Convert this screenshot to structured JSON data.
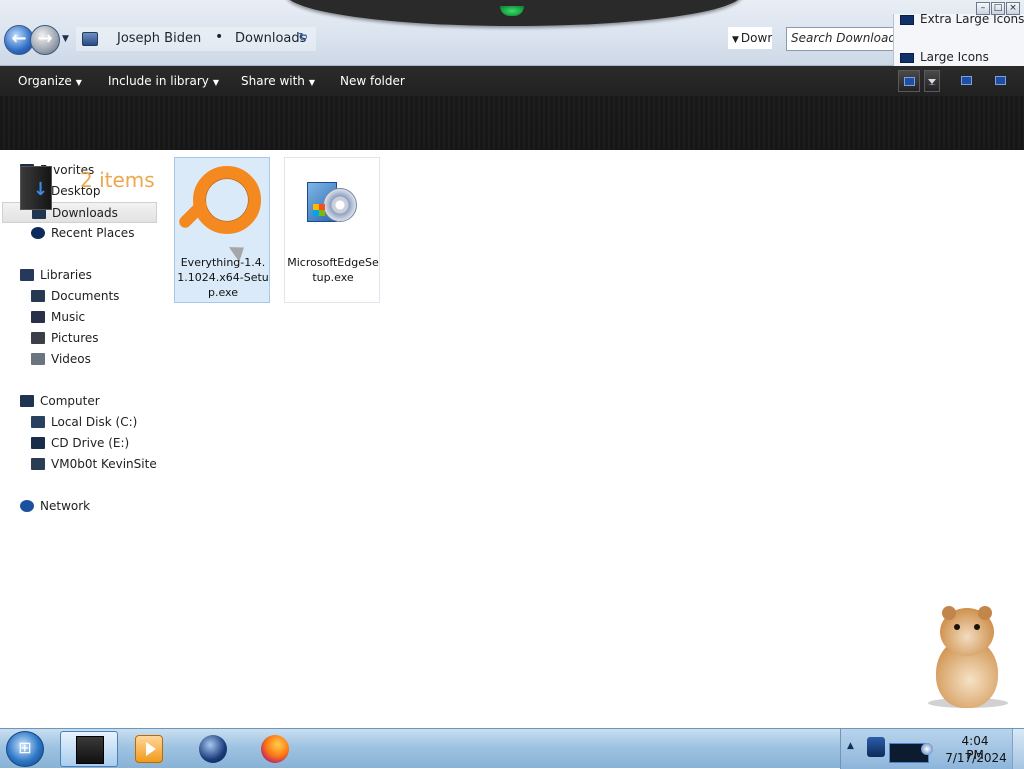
{
  "window": {
    "breadcrumb": [
      "Joseph Biden",
      "Downloads"
    ],
    "breadcrumb_separator": "•",
    "search_placeholder": "Search Downloads",
    "view_button_partial": "Dowr",
    "view_options": [
      "Extra Large Icons",
      "Large Icons"
    ],
    "controls": {
      "minimize": "–",
      "maximize": "□",
      "close": "×"
    }
  },
  "toolbar": {
    "organize": "Organize",
    "include_in_library": "Include in library",
    "share_with": "Share with",
    "new_folder": "New folder",
    "dropdown_glyph": "▼"
  },
  "header": {
    "item_count": "2 items",
    "accent_color": "#f0a64a"
  },
  "sidebar": {
    "favorites": {
      "label": "Favorites",
      "items": [
        "Desktop",
        "Downloads",
        "Recent Places"
      ],
      "selected": "Downloads"
    },
    "libraries": {
      "label": "Libraries",
      "items": [
        "Documents",
        "Music",
        "Pictures",
        "Videos"
      ]
    },
    "computer": {
      "label": "Computer",
      "items": [
        "Local Disk (C:)",
        "CD Drive (E:)",
        "VM0b0t KevinSite"
      ]
    },
    "network": {
      "label": "Network"
    }
  },
  "files": [
    {
      "name": "Everything-1.4.1.1024.x64-Setup.exe",
      "icon": "magnifier-icon",
      "selected": true
    },
    {
      "name": "MicrosoftEdgeSetup.exe",
      "icon": "setup-installer-icon",
      "selected": false
    }
  ],
  "taskbar": {
    "start_glyph": "⊞",
    "pinned": [
      "windows-explorer-icon",
      "media-player-icon",
      "internet-explorer-icon",
      "firefox-icon"
    ],
    "clock_time": "4:04 PM",
    "clock_date": "7/17/2024",
    "tray_expand_glyph": "▲"
  },
  "colors": {
    "toolbar_bg": "#1a1a1a",
    "selection_bg": "#dbeaf8",
    "taskbar_bg": "#9fc3e2"
  }
}
